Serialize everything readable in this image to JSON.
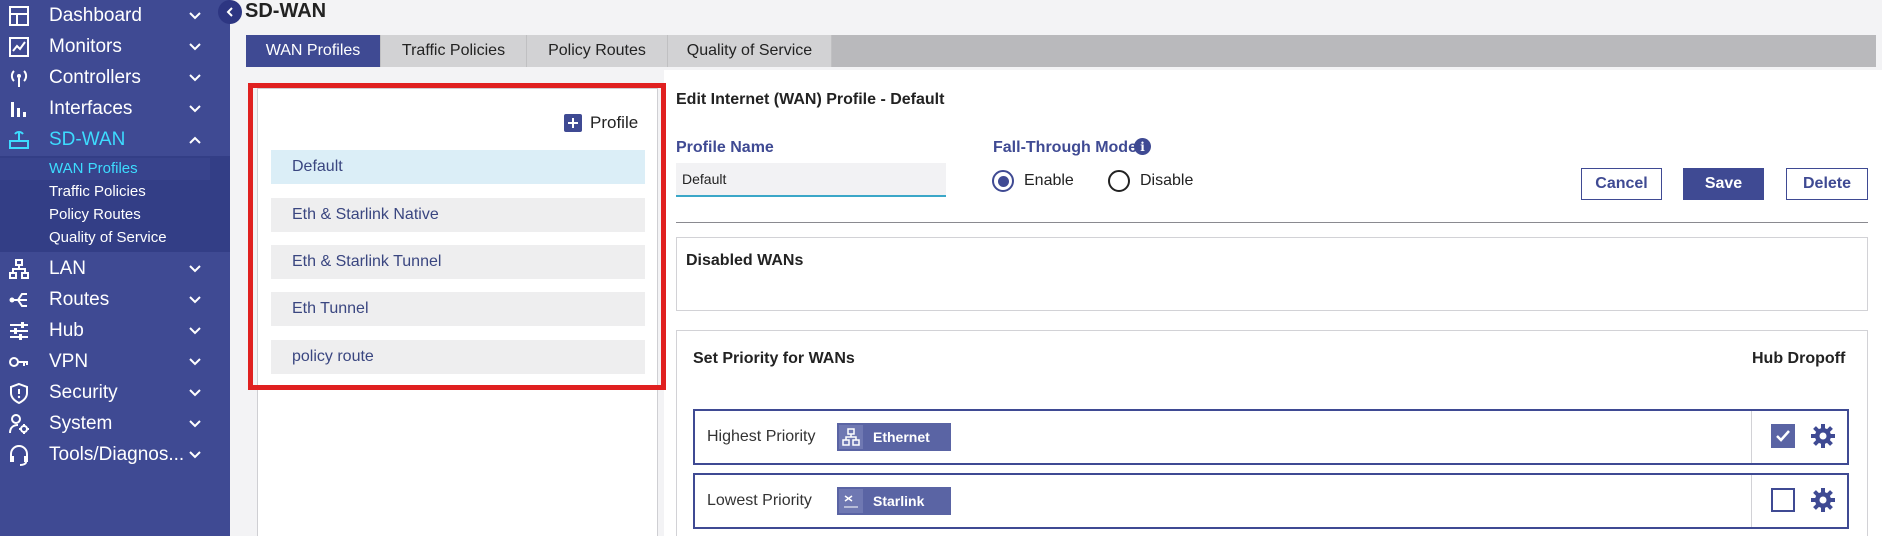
{
  "sidebar": {
    "items": [
      {
        "label": "Dashboard",
        "icon": "dashboard-icon"
      },
      {
        "label": "Monitors",
        "icon": "monitor-chart-icon"
      },
      {
        "label": "Controllers",
        "icon": "antenna-icon"
      },
      {
        "label": "Interfaces",
        "icon": "bar-chart-icon"
      },
      {
        "label": "SD-WAN",
        "icon": "router-icon"
      },
      {
        "label": "LAN",
        "icon": "lan-tree-icon"
      },
      {
        "label": "Routes",
        "icon": "routes-icon"
      },
      {
        "label": "Hub",
        "icon": "sliders-icon"
      },
      {
        "label": "VPN",
        "icon": "key-icon"
      },
      {
        "label": "Security",
        "icon": "shield-icon"
      },
      {
        "label": "System",
        "icon": "user-gear-icon"
      },
      {
        "label": "Tools/Diagnos...",
        "icon": "headset-icon"
      }
    ],
    "sdwan_sub": [
      {
        "label": "WAN Profiles"
      },
      {
        "label": "Traffic Policies"
      },
      {
        "label": "Policy Routes"
      },
      {
        "label": "Quality of Service"
      }
    ]
  },
  "page": {
    "title": "SD-WAN"
  },
  "tabs": [
    {
      "label": "WAN Profiles"
    },
    {
      "label": "Traffic Policies"
    },
    {
      "label": "Policy Routes"
    },
    {
      "label": "Quality of Service"
    }
  ],
  "profiles": {
    "add_label": "Profile",
    "items": [
      {
        "label": "Default"
      },
      {
        "label": "Eth & Starlink Native"
      },
      {
        "label": "Eth & Starlink Tunnel"
      },
      {
        "label": "Eth Tunnel"
      },
      {
        "label": "policy route"
      }
    ]
  },
  "editor": {
    "title": "Edit Internet (WAN) Profile - Default",
    "profile_name_label": "Profile Name",
    "profile_name_value": "Default",
    "fallthrough_label": "Fall-Through Mode",
    "fallthrough_info": "i",
    "enable_label": "Enable",
    "disable_label": "Disable",
    "cancel_label": "Cancel",
    "save_label": "Save",
    "delete_label": "Delete",
    "disabled_wans_title": "Disabled WANs",
    "priority_title": "Set Priority for WANs",
    "hub_dropoff_title": "Hub Dropoff",
    "wans": [
      {
        "priority": "Highest Priority",
        "name": "Ethernet",
        "icon": "ethernet-icon",
        "hub_dropoff": true
      },
      {
        "priority": "Lowest Priority",
        "name": "Starlink",
        "icon": "starlink-icon",
        "hub_dropoff": false
      }
    ]
  },
  "colors": {
    "brand": "#3f4a93",
    "active_text": "#3ddcff",
    "highlight": "#e02020"
  }
}
